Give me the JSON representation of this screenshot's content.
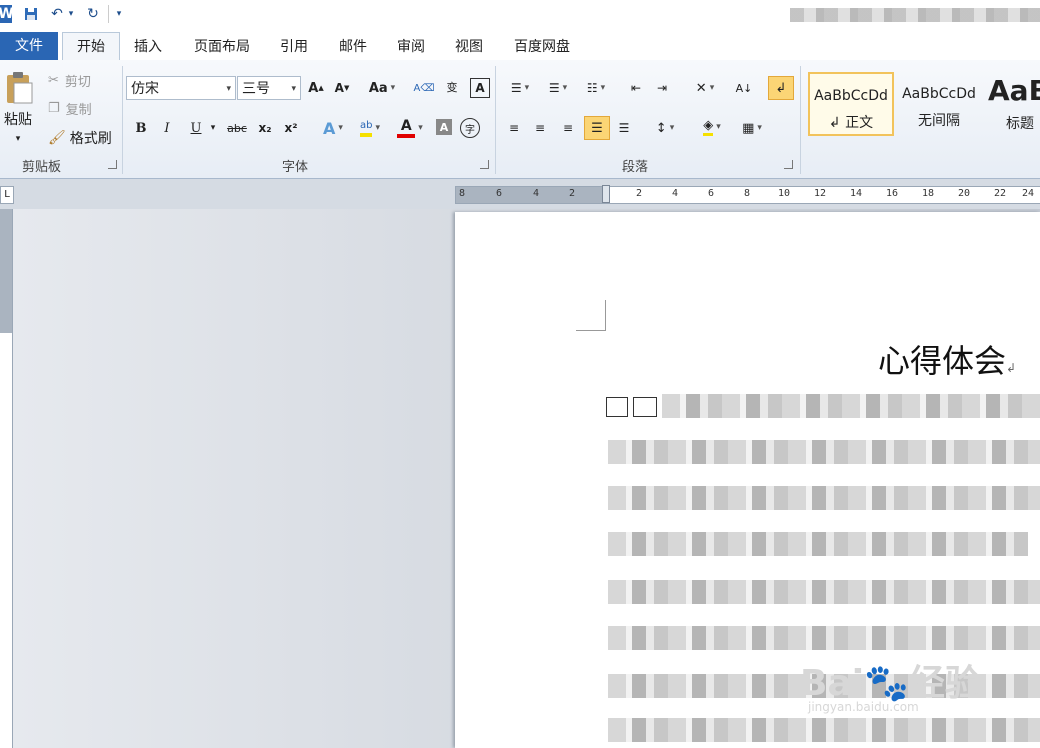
{
  "qat": {
    "word_icon": "W",
    "undo_icon": "↶",
    "redo_icon": "↻",
    "more_icon": "▾"
  },
  "tabs": [
    "文件",
    "开始",
    "插入",
    "页面布局",
    "引用",
    "邮件",
    "审阅",
    "视图",
    "百度网盘"
  ],
  "clipboard": {
    "paste": "粘贴",
    "cut": "剪切",
    "copy": "复制",
    "format_painter": "格式刷",
    "label": "剪贴板"
  },
  "font": {
    "name": "仿宋",
    "size": "三号",
    "label": "字体",
    "change_case": "Aa",
    "bold": "B",
    "italic": "I",
    "underline": "U",
    "strike": "abc",
    "sub": "x₂",
    "sup": "x²",
    "text_effect": "A",
    "highlight": "ab",
    "font_color": "A",
    "char_shading": "A",
    "enclose": "字",
    "phonetic": "wén",
    "char_border": "A"
  },
  "paragraph": {
    "label": "段落"
  },
  "styles": [
    {
      "preview": "AaBbCcDd",
      "name": "↲ 正文"
    },
    {
      "preview": "AaBbCcDd",
      "name": "无间隔"
    },
    {
      "preview": "AaB",
      "name": "标题"
    }
  ],
  "ruler": {
    "corner": "L",
    "numbers": [
      "8",
      "6",
      "4",
      "2",
      "2",
      "4",
      "6",
      "8",
      "10",
      "12",
      "14",
      "16",
      "18",
      "20",
      "22",
      "24"
    ]
  },
  "document": {
    "title": "心得体会",
    "paragraph_mark": "↲"
  },
  "watermark": {
    "logo": "Bai🐾经验",
    "url": "jingyan.baidu.com"
  },
  "colors": {
    "file_tab": "#2a66b4",
    "highlight": "#f5e000",
    "font_color": "#e00000",
    "active_button": "#fbd575"
  }
}
